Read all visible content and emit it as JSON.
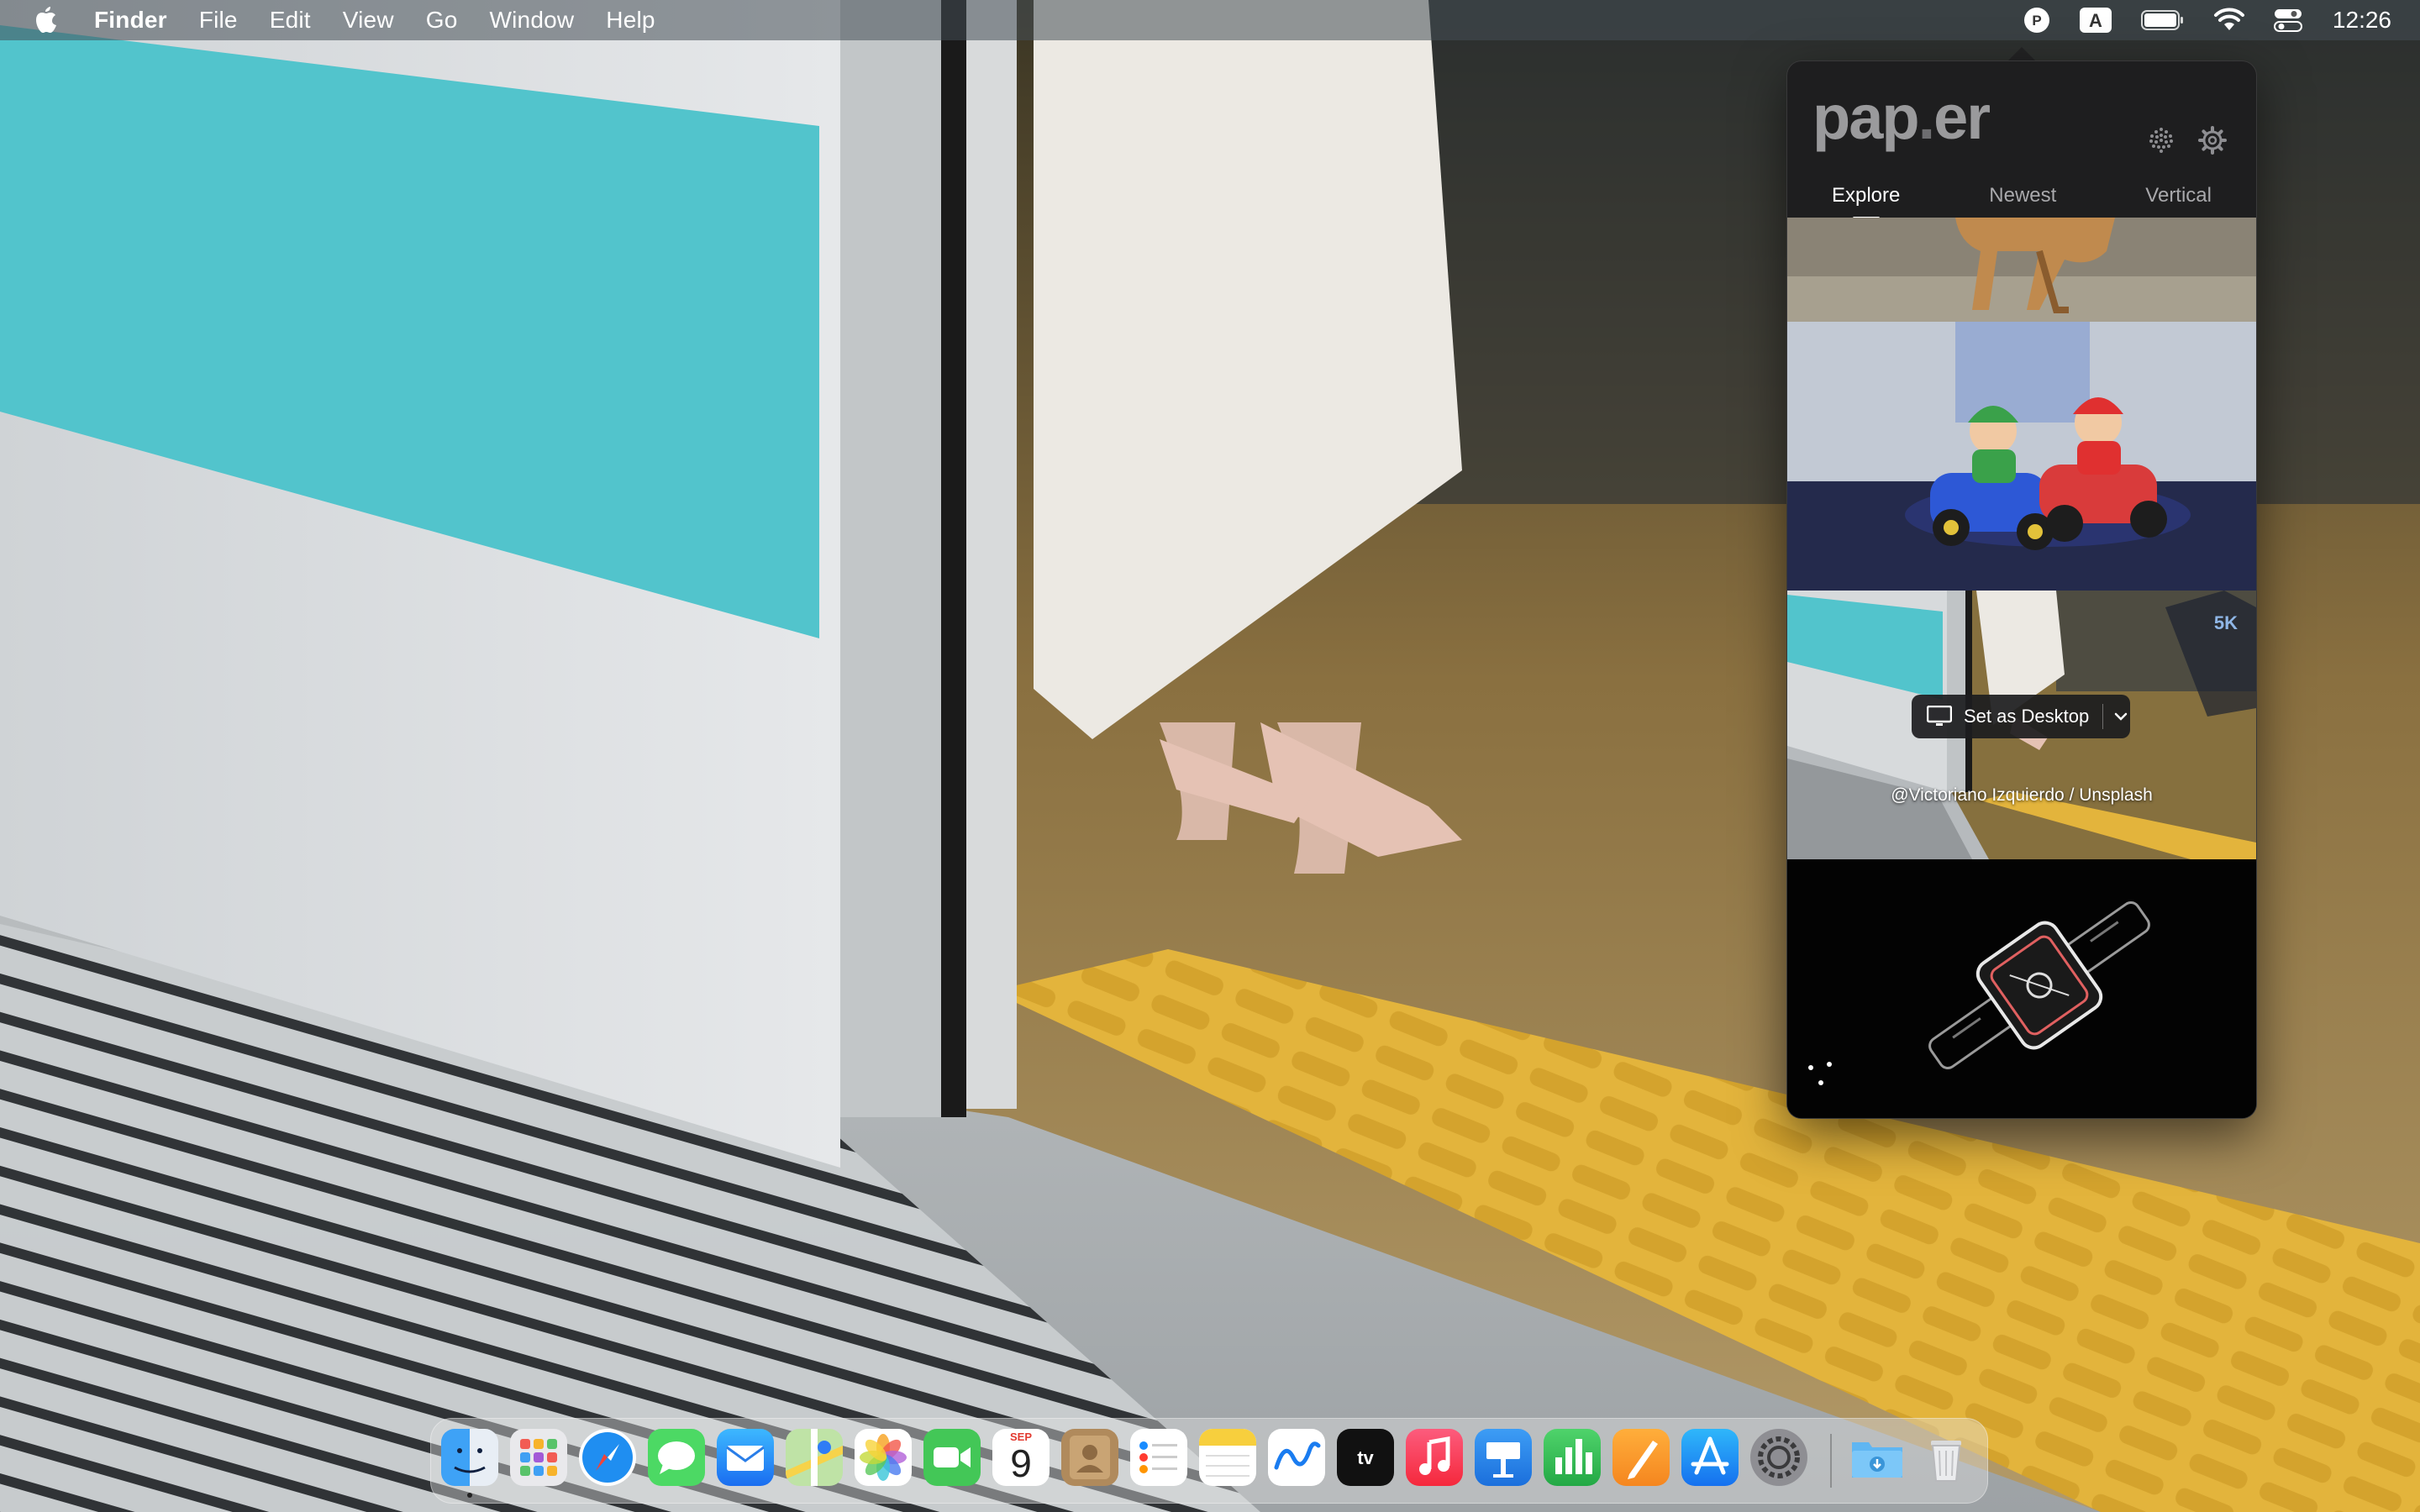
{
  "menubar": {
    "app_name": "Finder",
    "items": [
      "File",
      "Edit",
      "View",
      "Go",
      "Window",
      "Help"
    ],
    "clock": "12:26",
    "status_icons": [
      "paper-app-icon",
      "input-source-icon",
      "battery-icon",
      "wifi-icon",
      "control-center-icon"
    ]
  },
  "popover": {
    "logo": "pap",
    "logo_dot": ".",
    "logo_tail": "er",
    "tabs": [
      "Explore",
      "Newest",
      "Vertical"
    ],
    "active_tab": "Explore",
    "thumbnails": [
      {
        "name": "chair",
        "selected": false
      },
      {
        "name": "mario-karts",
        "selected": false
      },
      {
        "name": "train-door",
        "selected": true,
        "resolution_badge": "5K",
        "action_label": "Set as Desktop",
        "credit": "@Victoriano Izquierdo / Unsplash"
      },
      {
        "name": "watch",
        "selected": false
      }
    ]
  },
  "dock": {
    "apps": [
      "Finder",
      "Launchpad",
      "Safari",
      "Messages",
      "Mail",
      "Maps",
      "Photos",
      "FaceTime",
      "Calendar",
      "Contacts",
      "Reminders",
      "Notes",
      "Freeform",
      "TV",
      "Music",
      "Keynote",
      "Numbers",
      "Pages",
      "App Store",
      "System Settings",
      "Downloads",
      "Trash"
    ],
    "calendar_month": "SEP",
    "calendar_day": "9"
  },
  "colors": {
    "popover_bg": "#1e1e1f",
    "accent_badge": "#8fb6e6",
    "platform_yellow": "#e8b83a",
    "train_stripe": "#55c4cc"
  }
}
